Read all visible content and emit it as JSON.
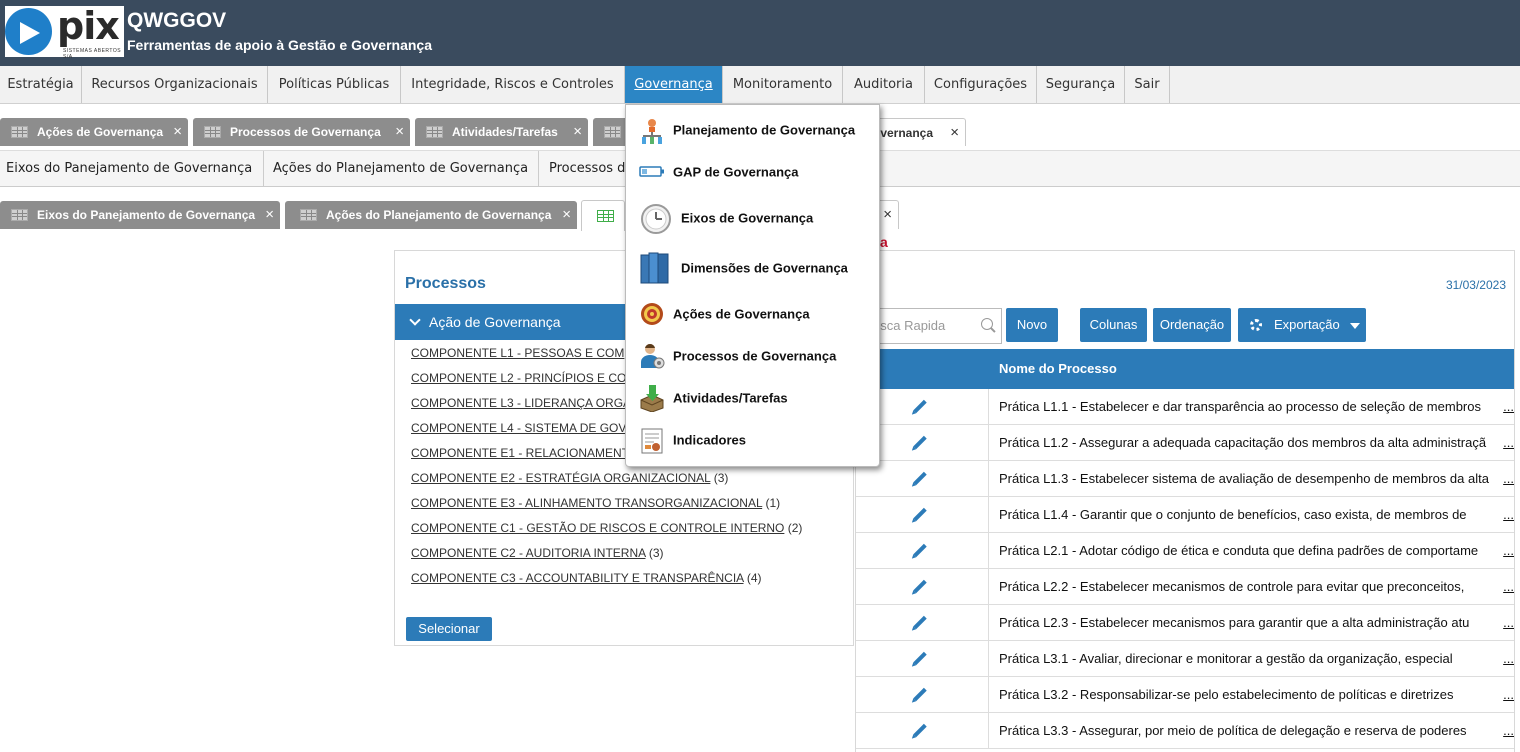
{
  "header": {
    "logo_text": "pix",
    "logo_subtitle": "SISTEMAS ABERTOS S/A",
    "title": "QWGGOV",
    "subtitle": "Ferramentas de apoio à Gestão e Governança"
  },
  "menu": [
    "Estratégia",
    "Recursos Organizacionais",
    "Políticas Públicas",
    "Integridade, Riscos e Controles",
    "Governança",
    "Monitoramento",
    "Auditoria",
    "Configurações",
    "Segurança",
    "Sair"
  ],
  "top_tabs": [
    "Ações de Governança",
    "Processos de Governança",
    "Atividades/Tarefas",
    "overnança"
  ],
  "submenu": [
    "Eixos do Panejamento de Governança",
    "Ações do Planejamento de Governança",
    "Processos d"
  ],
  "second_tabs": [
    "Eixos do Panejamento de Governança",
    "Ações do Planejamento de Governança"
  ],
  "close_glyph": "×",
  "governanca_dropdown": [
    {
      "label": "Planejamento de Governança",
      "icon": "org-chart-icon"
    },
    {
      "label": "GAP de Governança",
      "icon": "battery-icon"
    },
    {
      "label": "Eixos de Governança",
      "icon": "clock-icon"
    },
    {
      "label": "Dimensões de Governança",
      "icon": "books-icon"
    },
    {
      "label": "Ações de Governança",
      "icon": "target-icon"
    },
    {
      "label": "Processos de Governança",
      "icon": "user-process-icon"
    },
    {
      "label": "Atividades/Tarefas",
      "icon": "inbox-arrow-icon"
    },
    {
      "label": "Indicadores",
      "icon": "report-icon"
    }
  ],
  "left_panel": {
    "title": "Processos",
    "group_label": "Ação de Governança",
    "components": [
      {
        "label": "COMPONENTE L1 - PESSOAS E COM",
        "count": ""
      },
      {
        "label": "COMPONENTE L2 - PRINCÍPIOS E CO",
        "count": ""
      },
      {
        "label": "COMPONENTE L3 - LIDERANÇA ORGA",
        "count": ""
      },
      {
        "label": "COMPONENTE L4 - SISTEMA DE GOV",
        "count": ""
      },
      {
        "label": "COMPONENTE E1 - RELACIONAMENT",
        "count": ""
      },
      {
        "label": "COMPONENTE E2 - ESTRATÉGIA ORGANIZACIONAL",
        "count": "(3)"
      },
      {
        "label": "COMPONENTE E3 - ALINHAMENTO TRANSORGANIZACIONAL",
        "count": "(1)"
      },
      {
        "label": "COMPONENTE C1 - GESTÃO DE RISCOS E CONTROLE INTERNO",
        "count": "(2)"
      },
      {
        "label": "COMPONENTE C2 - AUDITORIA INTERNA",
        "count": "(3)"
      },
      {
        "label": "COMPONENTE C3 - ACCOUNTABILITY E TRANSPARÊNCIA",
        "count": "(4)"
      }
    ],
    "select_button": "Selecionar"
  },
  "right_panel": {
    "date": "31/03/2023",
    "search_placeholder": "usca Rapida",
    "buttons": {
      "novo": "Novo",
      "colunas": "Colunas",
      "ordenacao": "Ordenação",
      "exportacao": "Exportação"
    },
    "column_header": "Nome do Processo",
    "more_link": "...",
    "rows": [
      "Prática L1.1 - Estabelecer e dar transparência ao processo de seleção de membros",
      "Prática L1.2 - Assegurar a adequada capacitação dos membros da alta administraçã",
      "Prática L1.3 - Estabelecer sistema de avaliação de desempenho de membros da alta",
      "Prática L1.4 - Garantir que o conjunto de benefícios, caso exista, de membros de",
      "Prática L2.1 - Adotar código de ética e conduta que defina padrões de comportame",
      "Prática L2.2 - Estabelecer mecanismos de controle para evitar que preconceitos,",
      "Prática L2.3 - Estabelecer mecanismos para garantir que a alta administração atu",
      "Prática L3.1 - Avaliar, direcionar e monitorar a gestão da organização, especial",
      "Prática L3.2 - Responsabilizar-se pelo estabelecimento de políticas e diretrizes",
      "Prática L3.3 - Assegurar, por meio de política de delegação e reserva de poderes"
    ]
  },
  "colors": {
    "header_bg": "#3a4b5e",
    "accent_blue": "#2c7bb8",
    "tab_gray": "#8d8d8d"
  }
}
